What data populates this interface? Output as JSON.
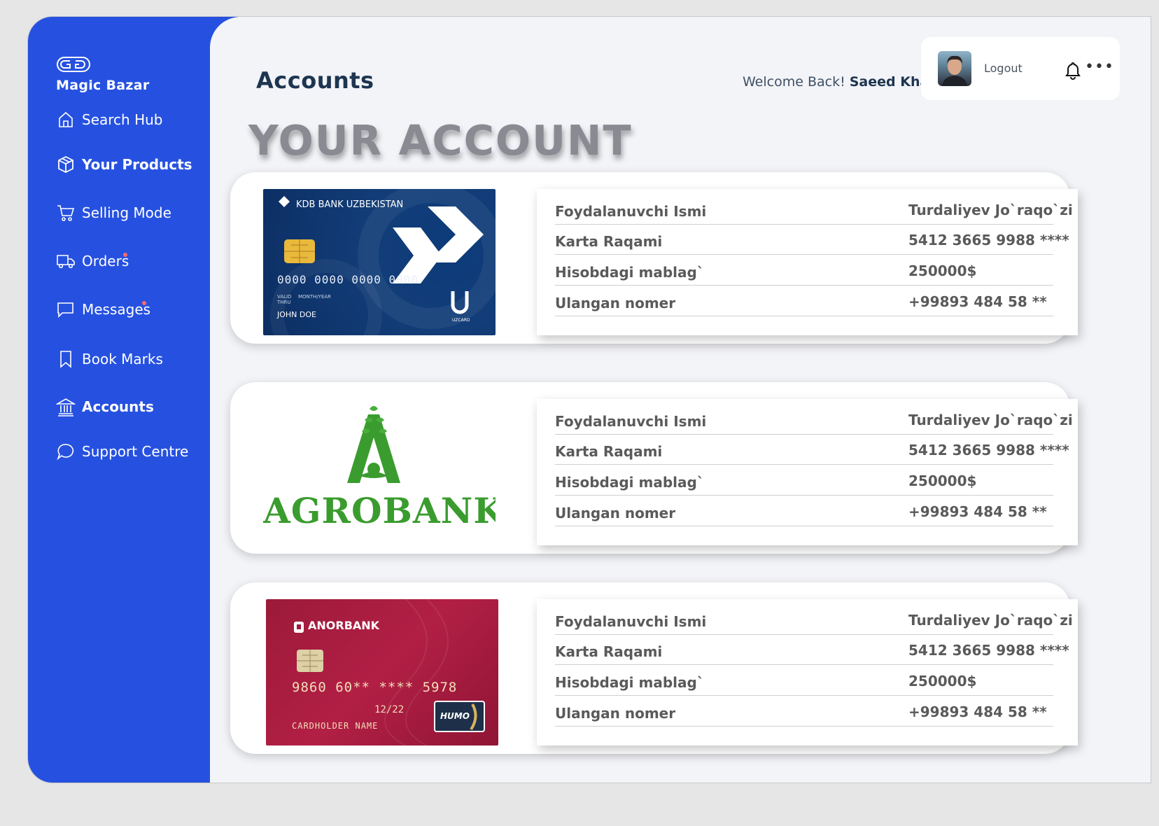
{
  "app": {
    "name": "Magic Bazar"
  },
  "sidebar": {
    "items": [
      {
        "label": "Search Hub",
        "icon": "home-icon"
      },
      {
        "label": "Your Products",
        "icon": "box-icon"
      },
      {
        "label": "Selling Mode",
        "icon": "cart-icon"
      },
      {
        "label": "Orders",
        "icon": "truck-icon"
      },
      {
        "label": "Messages",
        "icon": "message-icon"
      },
      {
        "label": "Book Marks",
        "icon": "bookmark-icon"
      },
      {
        "label": "Accounts",
        "icon": "bank-icon"
      },
      {
        "label": "Support Centre",
        "icon": "chat-bubble-icon"
      }
    ],
    "active": "Accounts"
  },
  "header": {
    "title": "Accounts",
    "welcome_prefix": "Welcome Back!",
    "user_name": "Saeed Khan",
    "logout_label": "Logout",
    "more_label": "•••"
  },
  "main": {
    "headline": "YOUR ACCOUNT",
    "accounts": [
      {
        "bank": "KDB BANK UZBEKISTAN",
        "card_number": "0000 0000 0000 0000",
        "card_valid": "VALID THRU",
        "card_month_year": "MONTH/YEAR",
        "card_holder": "JOHN DOE",
        "card_network": "UZCARD",
        "rows": [
          {
            "label": "Foydalanuvchi Ismi",
            "value": "Turdaliyev Jo`raqo`zi"
          },
          {
            "label": "Karta Raqami",
            "value": "5412 3665 9988 ****"
          },
          {
            "label": "Hisobdagi mablag`",
            "value": "250000$"
          },
          {
            "label": "Ulangan nomer",
            "value": "+99893 484 58 **"
          }
        ]
      },
      {
        "bank": "AGROBANK",
        "rows": [
          {
            "label": "Foydalanuvchi Ismi",
            "value": "Turdaliyev Jo`raqo`zi"
          },
          {
            "label": "Karta Raqami",
            "value": "5412 3665 9988 ****"
          },
          {
            "label": "Hisobdagi mablag`",
            "value": "250000$"
          },
          {
            "label": "Ulangan nomer",
            "value": "+99893 484 58 **"
          }
        ]
      },
      {
        "bank": "ANORBANK",
        "card_number": "9860 60** **** 5978",
        "card_expiry": "12/22",
        "card_holder": "CARDHOLDER NAME",
        "card_network": "HUMO",
        "rows": [
          {
            "label": "Foydalanuvchi Ismi",
            "value": "Turdaliyev Jo`raqo`zi"
          },
          {
            "label": "Karta Raqami",
            "value": "5412 3665 9988 ****"
          },
          {
            "label": "Hisobdagi mablag`",
            "value": "250000$"
          },
          {
            "label": "Ulangan nomer",
            "value": "+99893 484 58 **"
          }
        ]
      }
    ]
  },
  "colors": {
    "sidebar": "#2651e0",
    "title": "#1d3550",
    "agro_green": "#3a9c2e"
  }
}
